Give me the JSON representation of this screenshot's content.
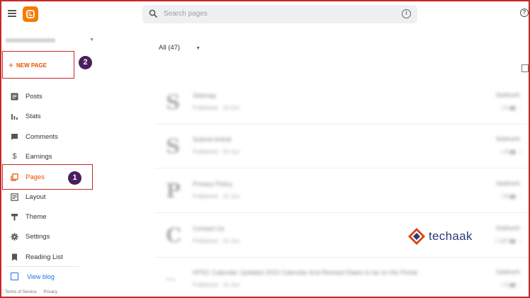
{
  "search": {
    "placeholder": "Search pages"
  },
  "sidebar": {
    "new_page_label": "NEW PAGE",
    "items": [
      {
        "label": "Posts",
        "icon": "posts-icon"
      },
      {
        "label": "Stats",
        "icon": "stats-icon"
      },
      {
        "label": "Comments",
        "icon": "comments-icon"
      },
      {
        "label": "Earnings",
        "icon": "dollar-icon"
      },
      {
        "label": "Pages",
        "icon": "pages-icon",
        "active": true
      },
      {
        "label": "Layout",
        "icon": "layout-icon"
      },
      {
        "label": "Theme",
        "icon": "paint-roller-icon"
      },
      {
        "label": "Settings",
        "icon": "gear-icon"
      },
      {
        "label": "Reading List",
        "icon": "bookmark-icon"
      }
    ],
    "view_blog_label": "View blog",
    "footer": {
      "terms": "Terms of Service",
      "privacy": "Privacy"
    }
  },
  "callouts": {
    "badge_1": "1",
    "badge_2": "2"
  },
  "main": {
    "filter_label": "All (47)",
    "rows": [
      {
        "letter": "S",
        "title": "Sitemap",
        "meta": "Published · 10 Oct",
        "author": "Siddharth",
        "stats": "6"
      },
      {
        "letter": "S",
        "title": "Submit Article",
        "meta": "Published · 20 Jun",
        "author": "Siddharth",
        "stats": "8"
      },
      {
        "letter": "P",
        "title": "Privacy Policy",
        "meta": "Published · 15 Jun",
        "author": "Siddharth",
        "stats": "8"
      },
      {
        "letter": "C",
        "title": "Contact Us",
        "meta": "Published · 15 Jun",
        "author": "Siddharth",
        "stats": "120"
      },
      {
        "letter": "…",
        "title": "KPSC Calendar Updated 2023 Calendar And Revised Dates to be on the Portal",
        "meta": "Published · 10 Jun",
        "author": "Siddharth",
        "stats": "4"
      }
    ]
  },
  "watermark": {
    "text": "techaak"
  },
  "colors": {
    "accent": "#e65100",
    "callout_border": "#c62828",
    "badge": "#4a1f5c",
    "link": "#1a73e8"
  }
}
